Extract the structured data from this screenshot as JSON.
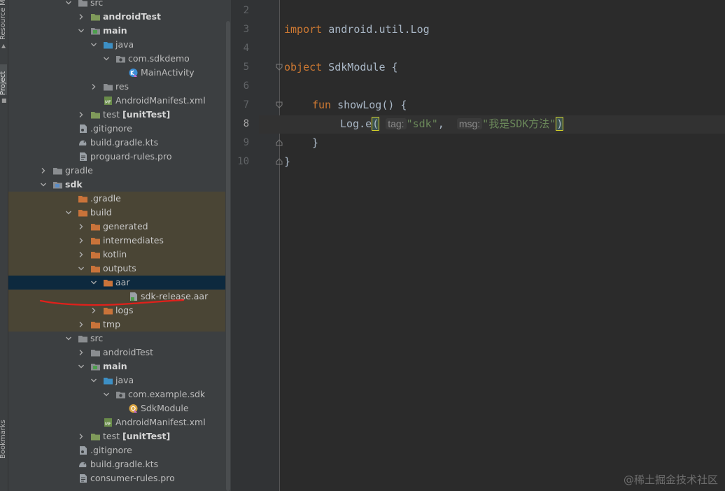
{
  "sidebar": {
    "resource_label": "Resource M",
    "project_label": "Project",
    "bookmarks_label": "Bookmarks"
  },
  "tree": [
    {
      "label": "src",
      "indent": 4,
      "chev": "down",
      "icon": "folder-gray"
    },
    {
      "label": "androidTest",
      "indent": 5,
      "chev": "right",
      "icon": "folder-green",
      "bold": true
    },
    {
      "label": "main",
      "indent": 5,
      "chev": "down",
      "icon": "folder-main",
      "bold": true
    },
    {
      "label": "java",
      "indent": 6,
      "chev": "down",
      "icon": "folder-blue"
    },
    {
      "label": "com.sdkdemo",
      "indent": 7,
      "chev": "down",
      "icon": "package"
    },
    {
      "label": "MainActivity",
      "indent": 8,
      "chev": "none",
      "icon": "kotlin-class"
    },
    {
      "label": "res",
      "indent": 6,
      "chev": "right",
      "icon": "folder-res"
    },
    {
      "label": "AndroidManifest.xml",
      "indent": 6,
      "chev": "none",
      "icon": "manifest"
    },
    {
      "label": "test",
      "suffix": "[unitTest]",
      "indent": 5,
      "chev": "right",
      "icon": "folder-green"
    },
    {
      "label": ".gitignore",
      "indent": 4,
      "chev": "none",
      "icon": "file-gitignore"
    },
    {
      "label": "build.gradle.kts",
      "indent": 4,
      "chev": "none",
      "icon": "gradle"
    },
    {
      "label": "proguard-rules.pro",
      "indent": 4,
      "chev": "none",
      "icon": "file"
    },
    {
      "label": "gradle",
      "indent": 2,
      "chev": "right",
      "icon": "folder-gray"
    },
    {
      "label": "sdk",
      "indent": 2,
      "chev": "down",
      "icon": "module",
      "bold": true
    },
    {
      "label": ".gradle",
      "indent": 4,
      "chev": "none",
      "icon": "folder-orange",
      "excluded": true
    },
    {
      "label": "build",
      "indent": 4,
      "chev": "down",
      "icon": "folder-orange",
      "excluded": true
    },
    {
      "label": "generated",
      "indent": 5,
      "chev": "right",
      "icon": "folder-orange",
      "excluded": true
    },
    {
      "label": "intermediates",
      "indent": 5,
      "chev": "right",
      "icon": "folder-orange",
      "excluded": true
    },
    {
      "label": "kotlin",
      "indent": 5,
      "chev": "right",
      "icon": "folder-orange",
      "excluded": true
    },
    {
      "label": "outputs",
      "indent": 5,
      "chev": "down",
      "icon": "folder-orange",
      "excluded": true
    },
    {
      "label": "aar",
      "indent": 6,
      "chev": "down",
      "icon": "folder-orange",
      "selected": true
    },
    {
      "label": "sdk-release.aar",
      "indent": 8,
      "chev": "none",
      "icon": "file-aar",
      "excluded": true
    },
    {
      "label": "logs",
      "indent": 6,
      "chev": "right",
      "icon": "folder-orange",
      "excluded": true
    },
    {
      "label": "tmp",
      "indent": 5,
      "chev": "right",
      "icon": "folder-orange",
      "excluded": true
    },
    {
      "label": "src",
      "indent": 4,
      "chev": "down",
      "icon": "folder-gray"
    },
    {
      "label": "androidTest",
      "indent": 5,
      "chev": "right",
      "icon": "folder-gray"
    },
    {
      "label": "main",
      "indent": 5,
      "chev": "down",
      "icon": "folder-main",
      "bold": true
    },
    {
      "label": "java",
      "indent": 6,
      "chev": "down",
      "icon": "folder-blue"
    },
    {
      "label": "com.example.sdk",
      "indent": 7,
      "chev": "down",
      "icon": "package"
    },
    {
      "label": "SdkModule",
      "indent": 8,
      "chev": "none",
      "icon": "kotlin-object"
    },
    {
      "label": "AndroidManifest.xml",
      "indent": 6,
      "chev": "none",
      "icon": "manifest"
    },
    {
      "label": "test",
      "suffix": "[unitTest]",
      "indent": 5,
      "chev": "right",
      "icon": "folder-green"
    },
    {
      "label": ".gitignore",
      "indent": 4,
      "chev": "none",
      "icon": "file-gitignore"
    },
    {
      "label": "build.gradle.kts",
      "indent": 4,
      "chev": "none",
      "icon": "gradle"
    },
    {
      "label": "consumer-rules.pro",
      "indent": 4,
      "chev": "none",
      "icon": "file"
    }
  ],
  "editor": {
    "line_numbers": [
      "2",
      "3",
      "4",
      "5",
      "6",
      "7",
      "8",
      "9",
      "10"
    ],
    "current_line": "8",
    "code": {
      "l3_kw": "import",
      "l3_rest": " android.util.Log",
      "l5_kw": "object",
      "l5_rest": " SdkModule {",
      "l7_kw": "fun",
      "l7_rest": " showLog() {",
      "l8_call": "Log.e",
      "l8_open": "(",
      "l8_hint_tag": "tag:",
      "l8_str_tag": "\"sdk\"",
      "l8_comma": ",",
      "l8_hint_msg": "msg:",
      "l8_str_msg": "\"我是SDK方法\"",
      "l8_close": ")",
      "l9": "}",
      "l10": "}"
    }
  },
  "watermark": "@稀土掘金技术社区"
}
